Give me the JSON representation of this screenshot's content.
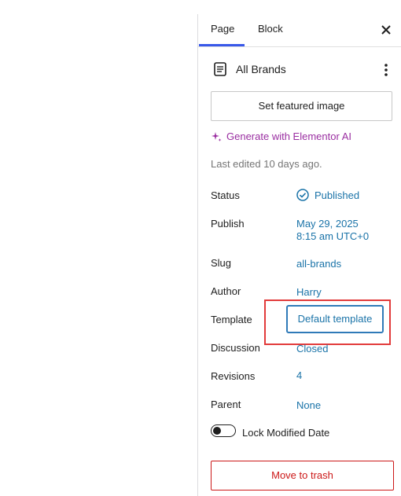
{
  "tabs": {
    "page": "Page",
    "block": "Block"
  },
  "document": {
    "title": "All Brands"
  },
  "buttons": {
    "set_featured_image": "Set featured image",
    "generate_ai": "Generate with Elementor AI",
    "move_to_trash": "Move to trash"
  },
  "meta": {
    "last_edited": "Last edited 10 days ago."
  },
  "rows": {
    "status_label": "Status",
    "status_value": "Published",
    "publish_label": "Publish",
    "publish_date": "May 29, 2025",
    "publish_time": "8:15 am UTC+0",
    "slug_label": "Slug",
    "slug_value": "all-brands",
    "author_label": "Author",
    "author_value": "Harry",
    "template_label": "Template",
    "template_value": "Default template",
    "discussion_label": "Discussion",
    "discussion_value": "Closed",
    "revisions_label": "Revisions",
    "revisions_value": "4",
    "parent_label": "Parent",
    "parent_value": "None"
  },
  "toggle": {
    "label": "Lock Modified Date",
    "enabled": false
  },
  "colors": {
    "accent": "#3858e9",
    "link": "#1a73a8",
    "ai_purple": "#9a2ea1",
    "danger": "#cc1818",
    "highlight": "#e23b3b"
  },
  "icons": {
    "close": "close-icon",
    "document": "document-icon",
    "more": "more-options-icon",
    "sparkle": "sparkle-icon",
    "status": "check-circle-icon"
  }
}
